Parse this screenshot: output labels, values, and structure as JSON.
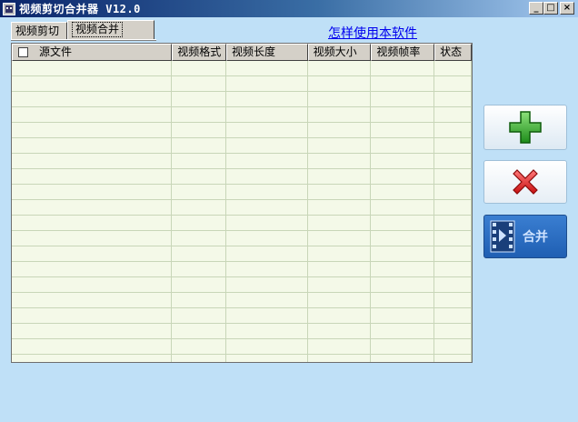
{
  "window": {
    "title": "视频剪切合并器 V12.0",
    "min_glyph": "_",
    "max_glyph": "□",
    "close_glyph": "×"
  },
  "tabs": [
    {
      "label": "视频剪切",
      "selected": false
    },
    {
      "label": "视频合并",
      "selected": true
    }
  ],
  "help_link": "怎样使用本软件",
  "table": {
    "columns": [
      "源文件",
      "视频格式",
      "视频长度",
      "视频大小",
      "视频帧率",
      "状态"
    ],
    "rows": []
  },
  "buttons": {
    "add_icon": "plus-icon",
    "delete_icon": "x-icon",
    "merge_icon": "film-icon",
    "merge_label": "合并"
  },
  "colors": {
    "background": "#bfe0f7",
    "grid_bg": "#f4f9e8",
    "add_green": "#2fa52a",
    "delete_red": "#e02020",
    "merge_blue": "#2a6cc4"
  }
}
